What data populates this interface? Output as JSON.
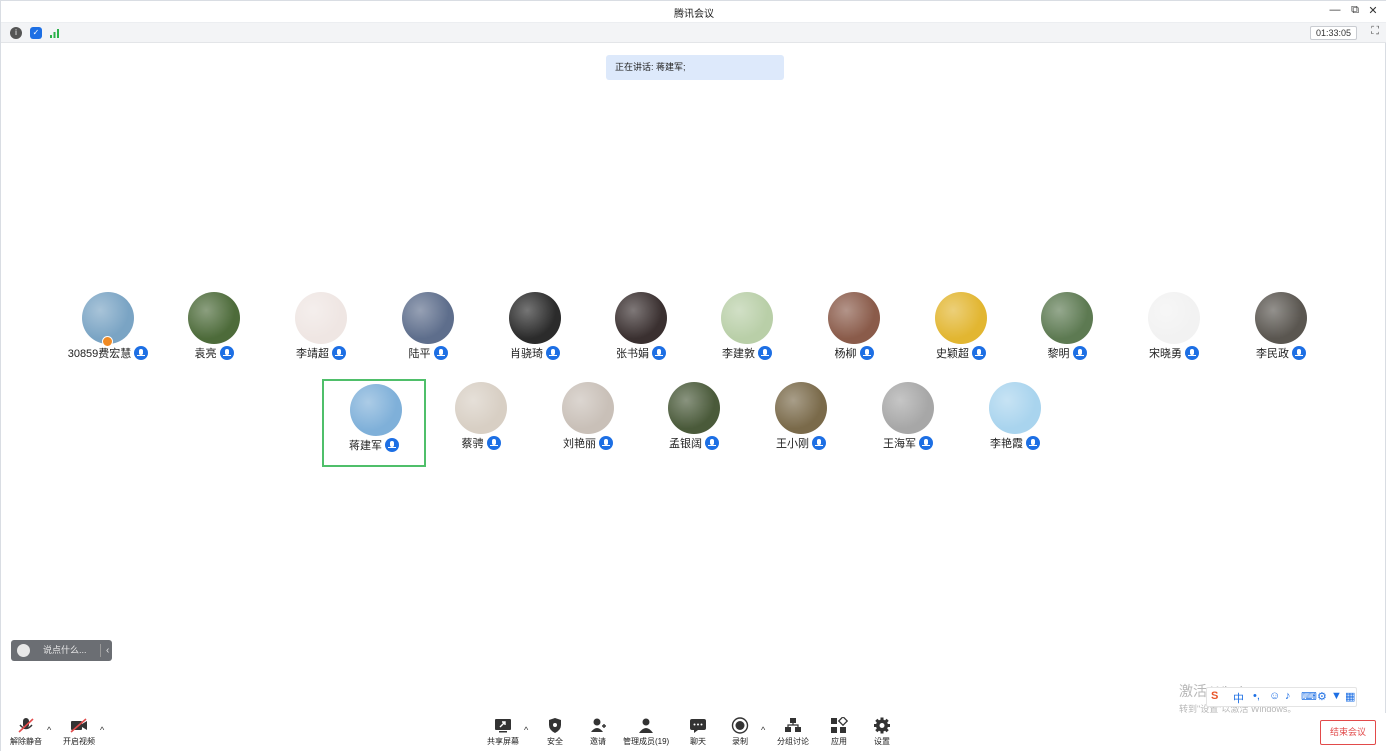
{
  "window": {
    "title": "腾讯会议",
    "minimize": "—",
    "restore": "⧉",
    "close": "✕"
  },
  "status": {
    "timer": "01:33:05",
    "fullscreen": "⛶"
  },
  "speaking": {
    "text": "正在讲话: 蒋建军;"
  },
  "participants_row1": [
    {
      "name": "30859费宏慧",
      "color": "#7aa4c4",
      "host": true
    },
    {
      "name": "袁亮",
      "color": "#4d6b3a"
    },
    {
      "name": "李靖超",
      "color": "#efe6e3"
    },
    {
      "name": "陆平",
      "color": "#5e6e8c"
    },
    {
      "name": "肖骁琦",
      "color": "#2b2b2b"
    },
    {
      "name": "张书娟",
      "color": "#3a3030"
    },
    {
      "name": "李建敦",
      "color": "#b9cfa8"
    },
    {
      "name": "杨柳",
      "color": "#8a5b4a"
    },
    {
      "name": "史颖超",
      "color": "#e2b631"
    },
    {
      "name": "黎明",
      "color": "#5d7a52"
    },
    {
      "name": "宋晓勇",
      "color": "#f2f2f2"
    },
    {
      "name": "李民政",
      "color": "#5a5650"
    }
  ],
  "participants_row2": [
    {
      "name": "蒋建军",
      "color": "#7fb0d9",
      "active": true
    },
    {
      "name": "蔡骋",
      "color": "#d8cfc4"
    },
    {
      "name": "刘艳丽",
      "color": "#c9c0b8"
    },
    {
      "name": "孟银阔",
      "color": "#4a5a3a"
    },
    {
      "name": "王小刚",
      "color": "#7a6a4a"
    },
    {
      "name": "王海军",
      "color": "#a7a7a7"
    },
    {
      "name": "李艳霞",
      "color": "#a9d4ee"
    }
  ],
  "chat": {
    "placeholder": "说点什么..."
  },
  "toolbar": {
    "unmute": "解除静音",
    "video": "开启视频",
    "share": "共享屏幕",
    "security": "安全",
    "invite": "邀请",
    "members": "管理成员(19)",
    "chat": "聊天",
    "record": "录制",
    "breakout": "分组讨论",
    "apps": "应用",
    "settings": "设置",
    "end": "结束会议"
  },
  "watermark": {
    "line1": "激活 Windows",
    "line2": "转到\"设置\"以激活 Windows。"
  },
  "ime": {
    "label": "中"
  }
}
